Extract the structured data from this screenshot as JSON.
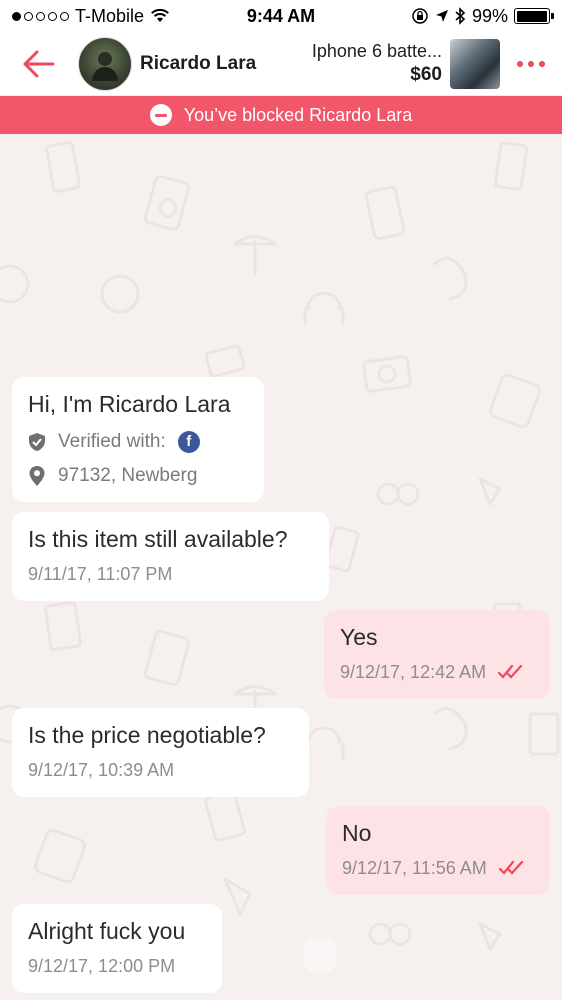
{
  "status_bar": {
    "carrier": "T-Mobile",
    "time": "9:44 AM",
    "battery": "99%",
    "battery_level": 0.99,
    "signal_bars_on": 1,
    "signal_bars_total": 5
  },
  "header": {
    "contact_name": "Ricardo Lara",
    "item_title": "Iphone 6 batte...",
    "item_price": "$60",
    "accent_color": "#f0475b"
  },
  "banner": {
    "text": "You’ve blocked Ricardo Lara",
    "color": "#f2566a"
  },
  "intro_card": {
    "greeting": "Hi, I'm Ricardo Lara",
    "verified_label": "Verified with:",
    "verified_icon": "facebook-icon",
    "location": "97132, Newberg"
  },
  "messages": [
    {
      "direction": "in",
      "text": "Is this item still available?",
      "time": "9/11/17, 11:07 PM"
    },
    {
      "direction": "out",
      "text": "Yes",
      "time": "9/12/17, 12:42 AM",
      "status_icon": "double-check-icon"
    },
    {
      "direction": "in",
      "text": "Is the price negotiable?",
      "time": "9/12/17, 10:39 AM"
    },
    {
      "direction": "out",
      "text": "No",
      "time": "9/12/17, 11:56 AM",
      "status_icon": "double-check-icon"
    },
    {
      "direction": "in",
      "text": "Alright fuck you",
      "time": "9/12/17, 12:00 PM"
    }
  ],
  "colors": {
    "background": "#f6f0ef",
    "incoming_bubble": "#ffffff",
    "outgoing_bubble": "#fde3e5",
    "read_check": "#f0475b"
  }
}
